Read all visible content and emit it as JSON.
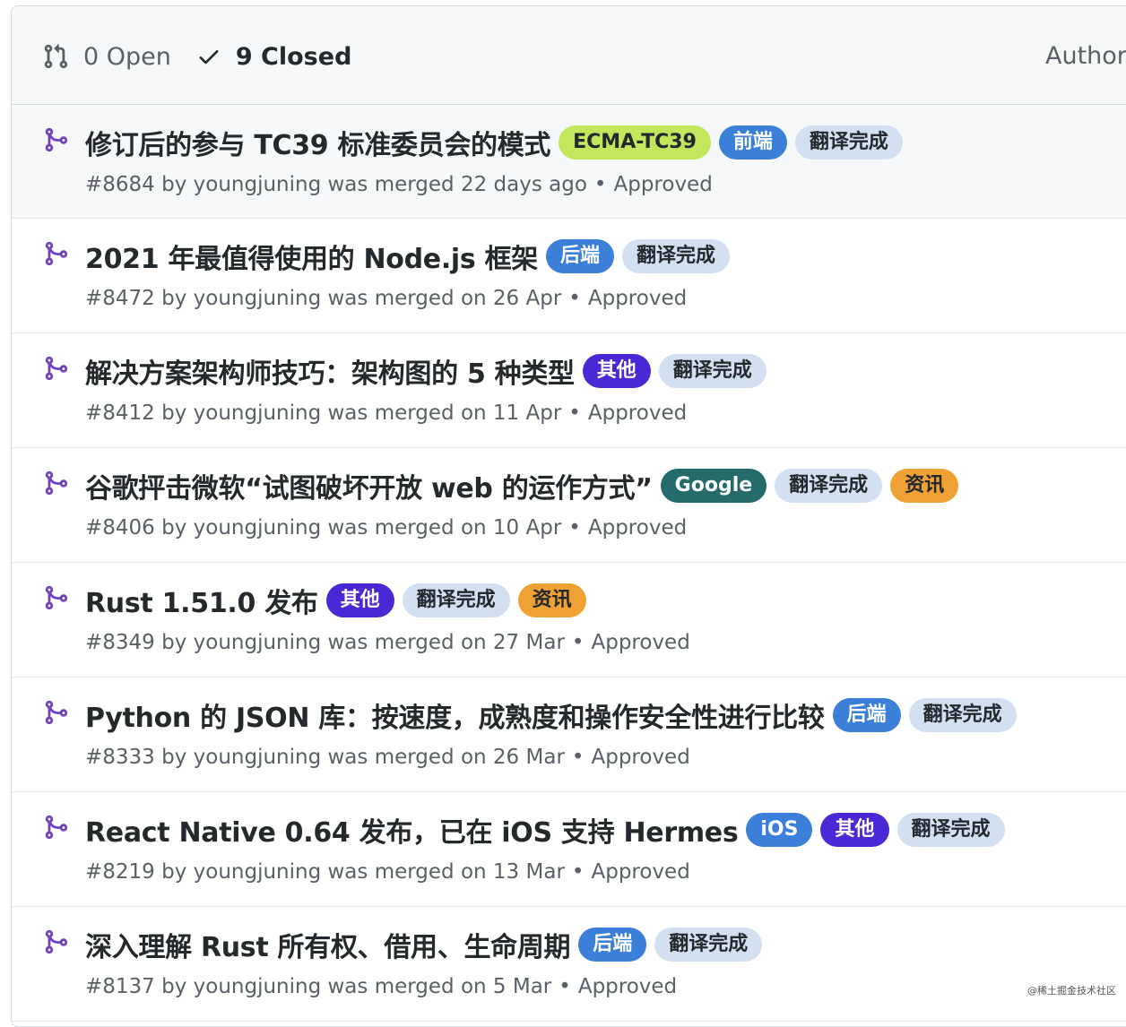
{
  "header": {
    "open_label": "0 Open",
    "closed_label": "9 Closed",
    "author_label": "Author"
  },
  "colors": {
    "merge_icon": "#6f42c1",
    "row_highlight": "#f6f8fa"
  },
  "pulls": [
    {
      "title": "修订后的参与 TC39 标准委员会的模式",
      "meta": "#8684 by youngjuning was merged 22 days ago",
      "review": "Approved",
      "labels": [
        {
          "text": "ECMA-TC39",
          "bg": "#c2e65c",
          "fg": "#24292e"
        },
        {
          "text": "前端",
          "bg": "#3b7fd9",
          "fg": "#ffffff"
        },
        {
          "text": "翻译完成",
          "bg": "#d2e0f1",
          "fg": "#24292e"
        }
      ]
    },
    {
      "title": "2021 年最值得使用的 Node.js 框架",
      "meta": "#8472 by youngjuning was merged on 26 Apr",
      "review": "Approved",
      "labels": [
        {
          "text": "后端",
          "bg": "#3b7fd9",
          "fg": "#ffffff"
        },
        {
          "text": "翻译完成",
          "bg": "#d2e0f1",
          "fg": "#24292e"
        }
      ]
    },
    {
      "title": "解决方案架构师技巧：架构图的 5 种类型",
      "meta": "#8412 by youngjuning was merged on 11 Apr",
      "review": "Approved",
      "labels": [
        {
          "text": "其他",
          "bg": "#4a28d6",
          "fg": "#ffffff"
        },
        {
          "text": "翻译完成",
          "bg": "#d2e0f1",
          "fg": "#24292e"
        }
      ]
    },
    {
      "title": "谷歌抨击微软“试图破坏开放 web 的运作方式”",
      "meta": "#8406 by youngjuning was merged on 10 Apr",
      "review": "Approved",
      "labels": [
        {
          "text": "Google",
          "bg": "#256b6b",
          "fg": "#ffffff"
        },
        {
          "text": "翻译完成",
          "bg": "#d2e0f1",
          "fg": "#24292e"
        },
        {
          "text": "资讯",
          "bg": "#f0a133",
          "fg": "#24292e"
        }
      ]
    },
    {
      "title": "Rust 1.51.0 发布",
      "meta": "#8349 by youngjuning was merged on 27 Mar",
      "review": "Approved",
      "labels": [
        {
          "text": "其他",
          "bg": "#4a28d6",
          "fg": "#ffffff"
        },
        {
          "text": "翻译完成",
          "bg": "#d2e0f1",
          "fg": "#24292e"
        },
        {
          "text": "资讯",
          "bg": "#f0a133",
          "fg": "#24292e"
        }
      ]
    },
    {
      "title": "Python 的 JSON 库：按速度，成熟度和操作安全性进行比较",
      "meta": "#8333 by youngjuning was merged on 26 Mar",
      "review": "Approved",
      "labels": [
        {
          "text": "后端",
          "bg": "#3b7fd9",
          "fg": "#ffffff"
        },
        {
          "text": "翻译完成",
          "bg": "#d2e0f1",
          "fg": "#24292e"
        }
      ]
    },
    {
      "title": "React Native 0.64 发布，已在 iOS 支持 Hermes",
      "meta": "#8219 by youngjuning was merged on 13 Mar",
      "review": "Approved",
      "labels": [
        {
          "text": "iOS",
          "bg": "#3b7fd9",
          "fg": "#ffffff"
        },
        {
          "text": "其他",
          "bg": "#4a28d6",
          "fg": "#ffffff"
        },
        {
          "text": "翻译完成",
          "bg": "#d2e0f1",
          "fg": "#24292e"
        }
      ]
    },
    {
      "title": "深入理解 Rust 所有权、借用、生命周期",
      "meta": "#8137 by youngjuning was merged on 5 Mar",
      "review": "Approved",
      "labels": [
        {
          "text": "后端",
          "bg": "#3b7fd9",
          "fg": "#ffffff"
        },
        {
          "text": "翻译完成",
          "bg": "#d2e0f1",
          "fg": "#24292e"
        }
      ]
    }
  ],
  "watermark": "@稀土掘金技术社区"
}
